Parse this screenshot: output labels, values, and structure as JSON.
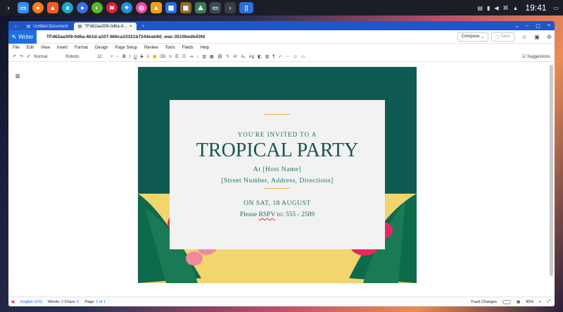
{
  "taskbar": {
    "icons": [
      "menu-icon",
      "files-icon",
      "firefox-icon",
      "brave-icon",
      "edge-icon",
      "chrome-icon",
      "browser-icon",
      "music-icon",
      "vivaldi-icon",
      "vlc-icon",
      "image-icon",
      "game-icon",
      "monitor-icon",
      "terminal-icon",
      "screen-icon"
    ],
    "clock": "19:41"
  },
  "tabs": [
    {
      "label": "Untitled Document"
    },
    {
      "label": "TFd62aa309-0d6a-4..."
    }
  ],
  "app": {
    "name": "Writer",
    "doc_title": "TFd62aa309-0d6a-4b1d-a107-666ca10321b7244eab9d_wac-3510bedb43fd",
    "compose": "Compose",
    "save": "Save"
  },
  "menu": [
    "File",
    "Edit",
    "View",
    "Insert",
    "Format",
    "Design",
    "Page Setup",
    "Review",
    "Tools",
    "Fields",
    "Help"
  ],
  "toolbar": {
    "style": "Normal",
    "font": "Roboto",
    "size": "12",
    "suggestions": "Suggestions"
  },
  "card": {
    "invited": "YOU'RE INVITED TO A",
    "title": "TROPICAL PARTY",
    "host": "At [Host Name]",
    "address": "[Street Number, Address, Directions]",
    "date": "ON SAT, 18 AUGUST",
    "rsvp_pre": "Please ",
    "rsvp_word": "RSPV",
    "rsvp_post": " to: 555 - 2589"
  },
  "status": {
    "lang": "English (US)",
    "words_label": "Words:",
    "words": "0",
    "chars_label": "Chars:",
    "chars": "0",
    "page_label": "Page:",
    "page": "1",
    "of": "of 1",
    "track": "Track Changes",
    "zoom": "90%"
  },
  "colors": {
    "accent": "#1e6fe0",
    "page_green": "#0f5a52",
    "yellow": "#f1d56e",
    "flower": "#e8295c"
  }
}
